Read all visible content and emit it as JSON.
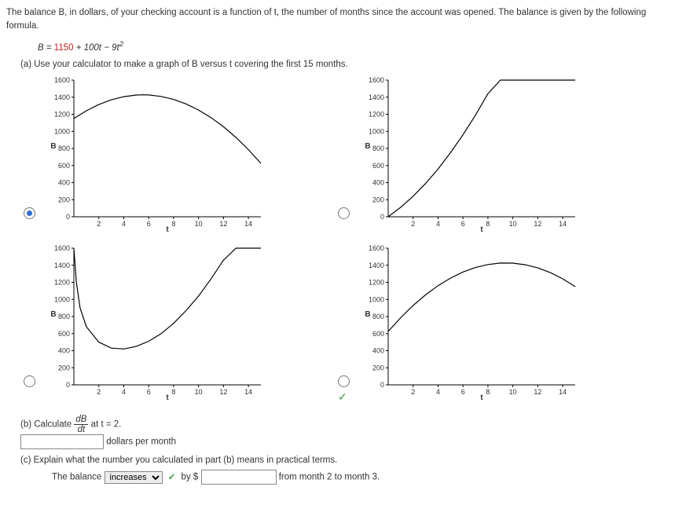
{
  "intro": "The balance B, in dollars, of your checking account is a function of t, the number of months since the account was opened. The balance is given by the following formula.",
  "formula_prefix": "B = ",
  "formula_c1": "1150",
  "formula_mid1": " + 100t − 9t",
  "formula_exp": "2",
  "partA_prompt": "(a) Use your calculator to make a graph of B versus t covering the first 15 months.",
  "partB_prefix": "(b) Calculate ",
  "frac_n": "dB",
  "frac_d": "dt",
  "partB_at": " at t = 2.",
  "partB_units": "dollars per month",
  "partB_answer": "",
  "partC_prompt": "(c) Explain what the number you calculated in part (b) means in practical terms.",
  "partC_sentence1": "The balance ",
  "partC_select": "increases",
  "partC_sentence2": " by $",
  "partC_input": "",
  "partC_sentence3": " from month 2 to month 3.",
  "chart_data": [
    {
      "type": "line",
      "title": "",
      "xlabel": "t",
      "ylabel": "B",
      "xlim": [
        0,
        15
      ],
      "ylim": [
        0,
        1600
      ],
      "xticks": [
        2,
        4,
        6,
        8,
        10,
        12,
        14
      ],
      "yticks": [
        0,
        200,
        400,
        600,
        800,
        1000,
        1200,
        1400,
        1600
      ],
      "x": [
        0,
        1,
        2,
        3,
        4,
        5,
        5.56,
        6,
        7,
        8,
        9,
        10,
        11,
        12,
        13,
        14,
        15
      ],
      "y": [
        1150,
        1241,
        1314,
        1369,
        1406,
        1425,
        1428,
        1426,
        1409,
        1374,
        1321,
        1250,
        1161,
        1054,
        929,
        786,
        625
      ],
      "selected": true
    },
    {
      "type": "line",
      "title": "",
      "xlabel": "t",
      "ylabel": "B",
      "xlim": [
        0,
        15
      ],
      "ylim": [
        0,
        1600
      ],
      "xticks": [
        2,
        4,
        6,
        8,
        10,
        12,
        14
      ],
      "yticks": [
        0,
        200,
        400,
        600,
        800,
        1000,
        1200,
        1400,
        1600
      ],
      "x": [
        0,
        1,
        2,
        3,
        4,
        5,
        6,
        7,
        8,
        9,
        10,
        11,
        12,
        13,
        14,
        15
      ],
      "y": [
        0,
        110,
        240,
        390,
        560,
        750,
        960,
        1190,
        1440,
        1600,
        1600,
        1600,
        1600,
        1600,
        1600,
        1600
      ],
      "selected": false
    },
    {
      "type": "line",
      "title": "",
      "xlabel": "t",
      "ylabel": "B",
      "xlim": [
        0,
        15
      ],
      "ylim": [
        0,
        1600
      ],
      "xticks": [
        2,
        4,
        6,
        8,
        10,
        12,
        14
      ],
      "yticks": [
        0,
        200,
        400,
        600,
        800,
        1000,
        1200,
        1400,
        1600
      ],
      "x": [
        0,
        0.2,
        0.5,
        1,
        2,
        3,
        4,
        5,
        6,
        7,
        8,
        9,
        10,
        11,
        12,
        13,
        14,
        15
      ],
      "y": [
        1600,
        1200,
        900,
        680,
        500,
        430,
        420,
        450,
        510,
        600,
        720,
        870,
        1040,
        1240,
        1460,
        1600,
        1600,
        1600
      ],
      "selected": false
    },
    {
      "type": "line",
      "title": "",
      "xlabel": "t",
      "ylabel": "B",
      "xlim": [
        0,
        15
      ],
      "ylim": [
        0,
        1600
      ],
      "xticks": [
        2,
        4,
        6,
        8,
        10,
        12,
        14
      ],
      "yticks": [
        0,
        200,
        400,
        600,
        800,
        1000,
        1200,
        1400,
        1600
      ],
      "x": [
        0,
        1,
        2,
        3,
        4,
        5,
        6,
        7,
        8,
        9,
        10,
        11,
        12,
        13,
        14,
        15
      ],
      "y": [
        625,
        786,
        929,
        1054,
        1161,
        1250,
        1321,
        1374,
        1409,
        1426,
        1425,
        1406,
        1369,
        1314,
        1241,
        1150
      ],
      "selected": false,
      "correct": true
    }
  ]
}
